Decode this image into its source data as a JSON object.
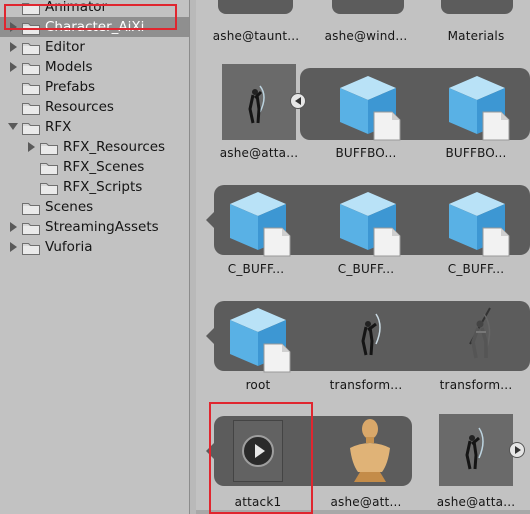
{
  "tree": {
    "items": [
      {
        "label": "Animator",
        "arrow": "none",
        "indent": 1
      },
      {
        "label": "Character_AiXi",
        "arrow": "right",
        "indent": 1,
        "selected": true
      },
      {
        "label": "Editor",
        "arrow": "right",
        "indent": 1
      },
      {
        "label": "Models",
        "arrow": "right",
        "indent": 1
      },
      {
        "label": "Prefabs",
        "arrow": "none",
        "indent": 1
      },
      {
        "label": "Resources",
        "arrow": "none",
        "indent": 1
      },
      {
        "label": "RFX",
        "arrow": "down",
        "indent": 1
      },
      {
        "label": "RFX_Resources",
        "arrow": "right",
        "indent": 2
      },
      {
        "label": "RFX_Scenes",
        "arrow": "none",
        "indent": 2
      },
      {
        "label": "RFX_Scripts",
        "arrow": "none",
        "indent": 2
      },
      {
        "label": "Scenes",
        "arrow": "none",
        "indent": 1
      },
      {
        "label": "StreamingAssets",
        "arrow": "right",
        "indent": 1
      },
      {
        "label": "Vuforia",
        "arrow": "right",
        "indent": 1
      }
    ]
  },
  "assets": {
    "row1": [
      "ashe@taunt...",
      "ashe@wind...",
      "Materials"
    ],
    "row2": [
      "ashe@atta...",
      "BUFFBO...",
      "BUFFBO..."
    ],
    "row3": [
      "C_BUFF...",
      "C_BUFF...",
      "C_BUFF..."
    ],
    "row4": [
      "root",
      "transform...",
      "transform..."
    ],
    "row5": [
      "attack1",
      "ashe@att...",
      "ashe@atta..."
    ]
  },
  "icons": {
    "folder": "folder-icon",
    "prefab": "prefab-cube-icon",
    "character": "archer-character-icon",
    "animation": "animation-clip-play-icon",
    "avatar": "avatar-mannequin-icon"
  },
  "colors": {
    "highlight": "#e0262f",
    "selection": "#8f8f8f",
    "panel_bg": "#c2c2c2",
    "group_bg": "#5c5c5c",
    "cube": "#5bb7ea"
  }
}
